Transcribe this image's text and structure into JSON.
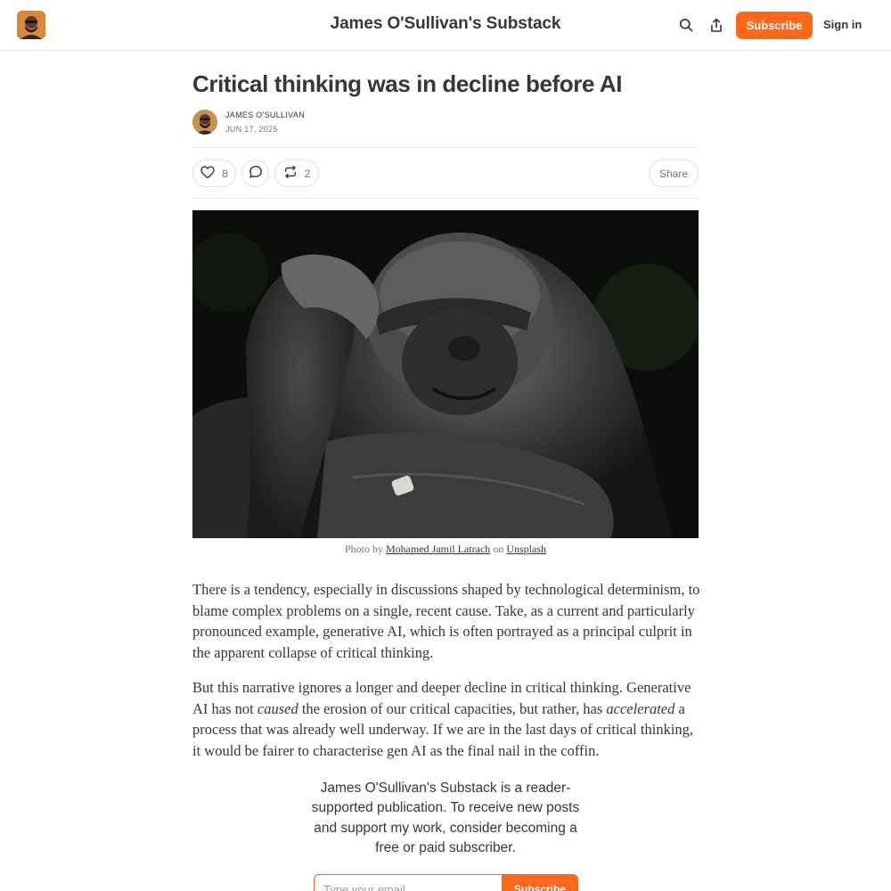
{
  "header": {
    "site_title": "James O'Sullivan's Substack",
    "subscribe_label": "Subscribe",
    "signin_label": "Sign in",
    "icons": [
      "search-icon",
      "share-icon"
    ]
  },
  "post": {
    "title": "Critical thinking was in decline before AI",
    "author": "JAMES O'SULLIVAN",
    "date": "JUN 17, 2025",
    "likes": "8",
    "restacks": "2",
    "share_label": "Share"
  },
  "caption": {
    "prefix": "Photo by ",
    "photographer": "Mohamed Jamil Latrach",
    "middle": " on ",
    "source": "Unsplash"
  },
  "body": {
    "p1": "There is a tendency, especially in discussions shaped by technological determinism, to blame complex problems on a single, recent cause. Take, as a current and particularly pronounced example, generative AI, which is often portrayed as a principal culprit in the apparent collapse of critical thinking.",
    "p2_a": "But this narrative ignores a longer and deeper decline in critical thinking. Generative AI has not ",
    "p2_em1": "caused",
    "p2_b": " the erosion of our critical capacities, but rather, has ",
    "p2_em2": "accelerated",
    "p2_c": " a process that was already well underway. If we are in the last days of critical thinking, it would be fairer to characterise gen AI as the final nail in the coffin."
  },
  "promo": {
    "text": "James O'Sullivan's Substack is a reader-supported publication. To receive new posts and support my work, consider becoming a free or paid subscriber.",
    "email_placeholder": "Type your email...",
    "subscribe_label": "Subscribe"
  },
  "colors": {
    "accent": "#ff6719",
    "text": "#363737",
    "muted": "#757575"
  }
}
